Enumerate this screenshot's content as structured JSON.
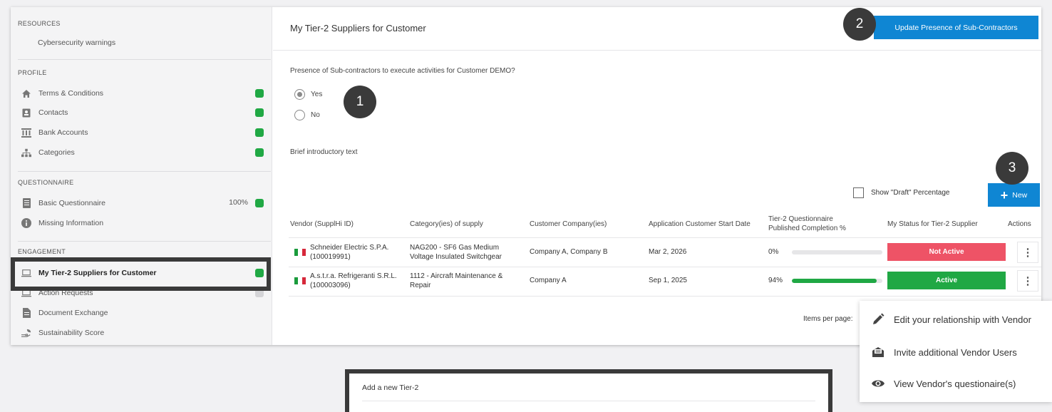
{
  "sidebar": {
    "resources": {
      "title": "RESOURCES",
      "items": [
        {
          "label": "Cybersecurity warnings"
        }
      ]
    },
    "profile": {
      "title": "PROFILE",
      "items": [
        {
          "label": "Terms & Conditions",
          "icon": "home-icon",
          "status": "green"
        },
        {
          "label": "Contacts",
          "icon": "contact-card-icon",
          "status": "green"
        },
        {
          "label": "Bank Accounts",
          "icon": "bank-icon",
          "status": "green"
        },
        {
          "label": "Categories",
          "icon": "hierarchy-icon",
          "status": "green"
        }
      ]
    },
    "questionnaire": {
      "title": "QUESTIONNAIRE",
      "items": [
        {
          "label": "Basic Questionnaire",
          "icon": "document-icon",
          "percent": "100%",
          "status": "green"
        },
        {
          "label": "Missing Information",
          "icon": "info-icon"
        }
      ]
    },
    "engagement": {
      "title": "ENGAGEMENT",
      "items": [
        {
          "label": "My Tier-2 Suppliers for Customer",
          "icon": "laptop-icon",
          "status": "green",
          "active": true
        },
        {
          "label": "Action Requests",
          "icon": "laptop-icon",
          "status": "grey"
        },
        {
          "label": "Document Exchange",
          "icon": "document-icon"
        },
        {
          "label": "Sustainability Score",
          "icon": "hand-leaf-icon"
        }
      ]
    }
  },
  "main": {
    "title": "My Tier-2 Suppliers for Customer",
    "update_button": "Update Presence of Sub-Contractors",
    "question": "Presence of Sub-contractors to execute activities for Customer DEMO?",
    "options": [
      {
        "label": "Yes",
        "checked": true
      },
      {
        "label": "No",
        "checked": false
      }
    ],
    "intro_text": "Brief introductory text",
    "show_draft_label": "Show \"Draft\" Percentage",
    "new_button": "New",
    "table": {
      "headers": [
        "Vendor (SupplHi ID)",
        "Category(ies) of supply",
        "Customer Company(ies)",
        "Application Customer Start Date",
        "Tier-2 Questionnaire Published Completion %",
        "My Status for Tier-2 Supplier",
        "Actions"
      ],
      "rows": [
        {
          "vendor": "Schneider Electric S.P.A.",
          "vendor_id": "(100019991)",
          "category": "NAG200 - SF6 Gas Medium Voltage Insulated Switchgear",
          "companies": "Company A, Company B",
          "start_date": "Mar 2, 2026",
          "completion_label": "0%",
          "completion": 0,
          "status": "Not Active"
        },
        {
          "vendor": "A.s.t.r.a. Refrigeranti S.R.L.",
          "vendor_id": "(100003096)",
          "category": "1112 - Aircraft Maintenance & Repair",
          "companies": "Company A",
          "start_date": "Sep 1, 2025",
          "completion_label": "94%",
          "completion": 94,
          "status": "Active"
        }
      ]
    },
    "items_per_page": "Items per page:"
  },
  "callouts": [
    "1",
    "2",
    "3"
  ],
  "actions_menu": [
    {
      "label": "Edit your relationship with Vendor",
      "icon": "pencil-icon"
    },
    {
      "label": "Invite additional Vendor Users",
      "icon": "mail-invite-icon"
    },
    {
      "label": "View Vendor's questionaire(s)",
      "icon": "eye-icon"
    }
  ],
  "dialog": {
    "title": "Add a new Tier-2"
  },
  "colors": {
    "primary": "#0f86d3",
    "active": "#20a844",
    "inactive": "#ee5366",
    "callout": "#3a3a3a"
  }
}
